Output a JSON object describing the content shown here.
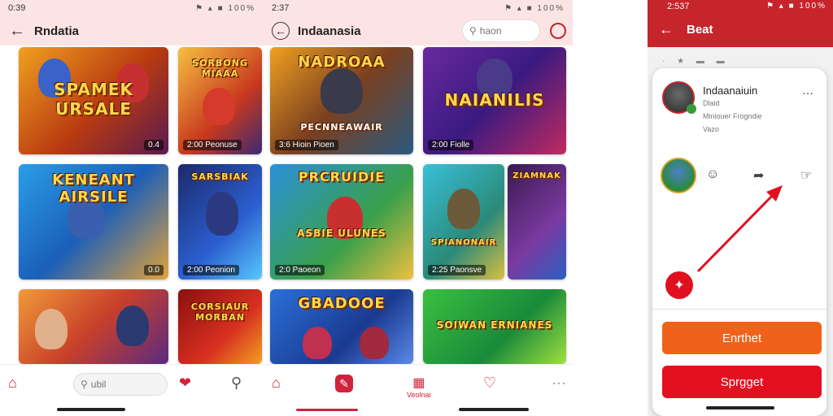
{
  "screen1": {
    "status_time": "0:39",
    "status_icons": "⚑ ▴ ■ 100%",
    "title": "Rndatia",
    "tiles": [
      {
        "title": "SPAMEK URSALE",
        "caption": "0.4"
      },
      {
        "title": "SORBONG MIAAA",
        "caption": "2:00 Peonuse"
      },
      {
        "title": "KENEANT AIRSILE",
        "caption": "0.0"
      },
      {
        "title": "SARSBIAK",
        "caption": "2:00 Peonion"
      },
      {
        "title": "",
        "caption": ""
      },
      {
        "title": "CORSIAUR MORBAN",
        "caption": ""
      }
    ],
    "search_placeholder": "ubil"
  },
  "screen2": {
    "status_time": "2:37",
    "status_icons": "⚑ ▴ ■ 100%",
    "title": "Indaanasia",
    "search_placeholder": "haon",
    "tiles": [
      {
        "title": "NADROAA",
        "sub": "PECNNEAWAIR",
        "caption": "3:6 Hioin Pioen"
      },
      {
        "title": "NAIANILIS",
        "caption": "2:00 Fiolle"
      },
      {
        "title": "PRCRUIDIE",
        "sub": "ASBIE ULUNES",
        "caption": "2:0 Paoeon"
      },
      {
        "title": "SPIANONAIR",
        "caption": "2:25 Paonsve"
      },
      {
        "title": "ZIAMNAK",
        "caption": ""
      },
      {
        "title": "GBADOOE",
        "caption": ""
      },
      {
        "title": "SOIWAN ERNIANES",
        "caption": ""
      }
    ],
    "nav_label": "Veolnai"
  },
  "screen3": {
    "status_time": "2:537",
    "status_icons": "⚑ ▴ ■ 100%",
    "title": "Beat",
    "profile_name": "Indaanaiuin",
    "profile_line1": "Dlaid",
    "profile_line2": "Miniouer Frogndie",
    "profile_line3": "Vazo",
    "btn_primary": "Enrthet",
    "btn_secondary": "Sprgget"
  },
  "colors": {
    "brand_red": "#c6252b",
    "orange": "#f0621a",
    "red_button": "#e5101f"
  }
}
